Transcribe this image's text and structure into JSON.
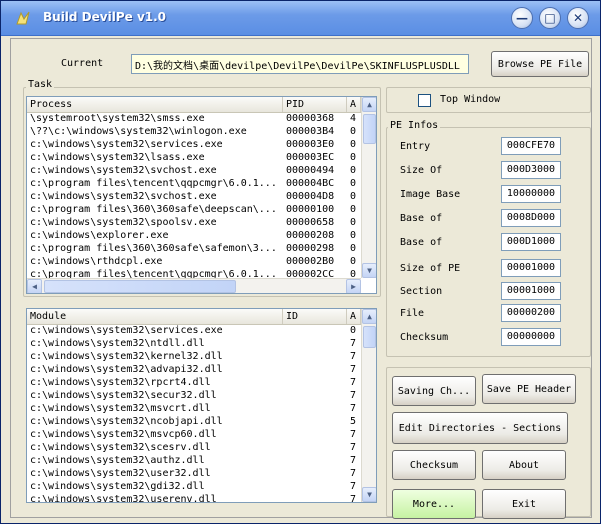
{
  "window": {
    "title": "Build DevilPe v1.0"
  },
  "current": {
    "label": "Current",
    "path": "D:\\我的文档\\桌面\\devilpe\\DevilPe\\DevilPe\\SKINFLUSPLUSDLL"
  },
  "browse_button": "Browse PE File",
  "task": {
    "label": "Task",
    "columns": [
      "Process",
      "PID",
      "A"
    ],
    "rows": [
      [
        "\\systemroot\\system32\\smss.exe",
        "00000368",
        "4"
      ],
      [
        "\\??\\c:\\windows\\system32\\winlogon.exe",
        "000003B4",
        "0"
      ],
      [
        "c:\\windows\\system32\\services.exe",
        "000003E0",
        "0"
      ],
      [
        "c:\\windows\\system32\\lsass.exe",
        "000003EC",
        "0"
      ],
      [
        "c:\\windows\\system32\\svchost.exe",
        "00000494",
        "0"
      ],
      [
        "c:\\program files\\tencent\\qqpcmgr\\6.0.1...",
        "000004BC",
        "0"
      ],
      [
        "c:\\windows\\system32\\svchost.exe",
        "000004D8",
        "0"
      ],
      [
        "c:\\program files\\360\\360safe\\deepscan\\...",
        "00000100",
        "0"
      ],
      [
        "c:\\windows\\system32\\spoolsv.exe",
        "00000658",
        "0"
      ],
      [
        "c:\\windows\\explorer.exe",
        "00000208",
        "0"
      ],
      [
        "c:\\program files\\360\\360safe\\safemon\\3...",
        "00000298",
        "0"
      ],
      [
        "c:\\windows\\rthdcpl.exe",
        "000002B0",
        "0"
      ],
      [
        "c:\\program files\\tencent\\qqpcmgr\\6.0.1...",
        "000002CC",
        "0"
      ]
    ]
  },
  "module": {
    "columns": [
      "Module",
      "ID",
      "A"
    ],
    "rows": [
      [
        "c:\\windows\\system32\\services.exe",
        "",
        "0"
      ],
      [
        "c:\\windows\\system32\\ntdll.dll",
        "",
        "7"
      ],
      [
        "c:\\windows\\system32\\kernel32.dll",
        "",
        "7"
      ],
      [
        "c:\\windows\\system32\\advapi32.dll",
        "",
        "7"
      ],
      [
        "c:\\windows\\system32\\rpcrt4.dll",
        "",
        "7"
      ],
      [
        "c:\\windows\\system32\\secur32.dll",
        "",
        "7"
      ],
      [
        "c:\\windows\\system32\\msvcrt.dll",
        "",
        "7"
      ],
      [
        "c:\\windows\\system32\\ncobjapi.dll",
        "",
        "5"
      ],
      [
        "c:\\windows\\system32\\msvcp60.dll",
        "",
        "7"
      ],
      [
        "c:\\windows\\system32\\scesrv.dll",
        "",
        "7"
      ],
      [
        "c:\\windows\\system32\\authz.dll",
        "",
        "7"
      ],
      [
        "c:\\windows\\system32\\user32.dll",
        "",
        "7"
      ],
      [
        "c:\\windows\\system32\\gdi32.dll",
        "",
        "7"
      ],
      [
        "c:\\windows\\system32\\userenv.dll",
        "",
        "7"
      ]
    ]
  },
  "top_window": {
    "label": "Top Window",
    "checked": false
  },
  "pe_infos": {
    "label": "PE Infos",
    "fields": [
      {
        "label": "Entry",
        "value": "000CFE70"
      },
      {
        "label": "Size Of",
        "value": "000D3000"
      },
      {
        "label": "Image Base",
        "value": "10000000"
      },
      {
        "label": "Base of",
        "value": "0008D000"
      },
      {
        "label": "Base of",
        "value": "000D1000"
      },
      {
        "label": "Size of PE",
        "value": "00001000"
      },
      {
        "label": "Section",
        "value": "00001000"
      },
      {
        "label": "File",
        "value": "00000200"
      },
      {
        "label": "Checksum",
        "value": "00000000"
      }
    ]
  },
  "buttons": {
    "saving": "Saving Ch...",
    "save_pe_header": "Save PE Header",
    "edit_dirs": "Edit Directories - Sections",
    "checksum": "Checksum",
    "about": "About",
    "more": "More...",
    "exit": "Exit"
  }
}
